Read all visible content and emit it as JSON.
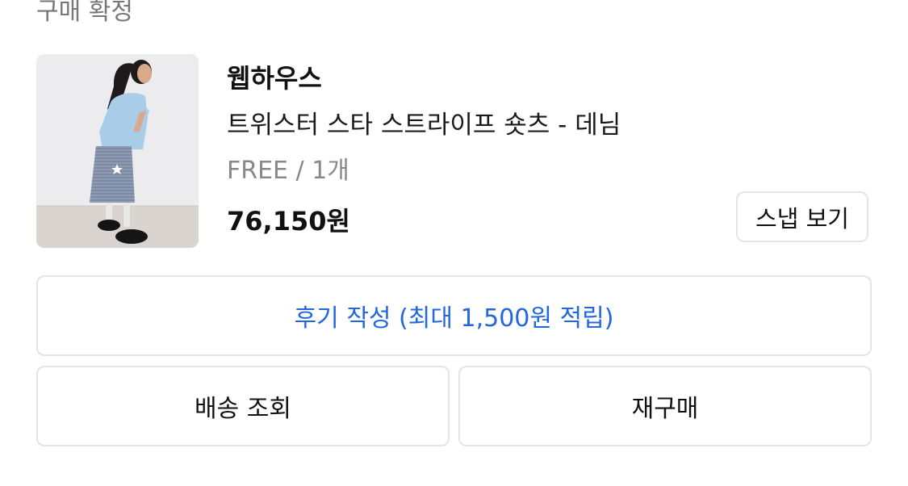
{
  "order": {
    "status_label": "구매 확정"
  },
  "product": {
    "brand": "웹하우스",
    "name": "트위스터 스타 스트라이프 숏츠 - 데님",
    "option": "FREE / 1개",
    "price": "76,150원",
    "image_icon": "product-photo"
  },
  "actions": {
    "snap_label": "스냅 보기",
    "review_label": "후기 작성 (최대 1,500원 적립)",
    "tracking_label": "배송 조회",
    "rebuy_label": "재구매"
  },
  "colors": {
    "accent": "#2266e0",
    "border": "#e4e4e4",
    "muted_text": "#888888"
  }
}
